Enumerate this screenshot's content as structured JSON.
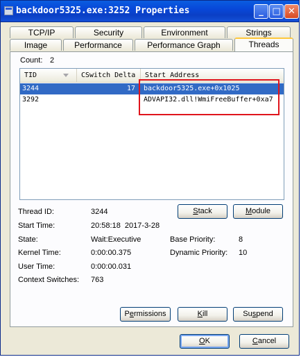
{
  "window": {
    "title": "backdoor5325.exe:3252 Properties"
  },
  "tabs_back": [
    "TCP/IP",
    "Security",
    "Environment",
    "Strings"
  ],
  "tabs_front": [
    "Image",
    "Performance",
    "Performance Graph",
    "Threads"
  ],
  "active_tab": "Threads",
  "count": {
    "label": "Count:",
    "value": "2"
  },
  "columns": [
    "TID",
    "CSwitch Delta",
    "Start Address"
  ],
  "threads": [
    {
      "tid": "3244",
      "cswitch": "17",
      "start": "backdoor5325.exe+0x1025"
    },
    {
      "tid": "3292",
      "cswitch": "",
      "start": "ADVAPI32.dll!WmiFreeBuffer+0xa7"
    }
  ],
  "details": {
    "thread_id_label": "Thread ID:",
    "thread_id": "3244",
    "start_time_label": "Start Time:",
    "start_time": "20:58:18  2017-3-28",
    "state_label": "State:",
    "state": "Wait:Executive",
    "base_priority_label": "Base Priority:",
    "base_priority": "8",
    "kernel_time_label": "Kernel Time:",
    "kernel_time": "0:00:00.375",
    "dynamic_priority_label": "Dynamic Priority:",
    "dynamic_priority": "10",
    "user_time_label": "User Time:",
    "user_time": "0:00:00.031",
    "context_switches_label": "Context Switches:",
    "context_switches": "763"
  },
  "buttons": {
    "stack": {
      "acc": "S",
      "rest": "tack"
    },
    "module": {
      "acc": "M",
      "rest": "odule"
    },
    "permissions": {
      "pre": "P",
      "acc": "e",
      "rest": "rmissions"
    },
    "kill": {
      "acc": "K",
      "rest": "ill"
    },
    "suspend": {
      "pre": "Su",
      "acc": "s",
      "rest": "pend"
    },
    "ok": {
      "acc": "O",
      "rest": "K"
    },
    "cancel": {
      "acc": "C",
      "rest": "ancel"
    }
  },
  "title_buttons": {
    "minimize": "_",
    "maximize": "□",
    "close": "✕"
  }
}
